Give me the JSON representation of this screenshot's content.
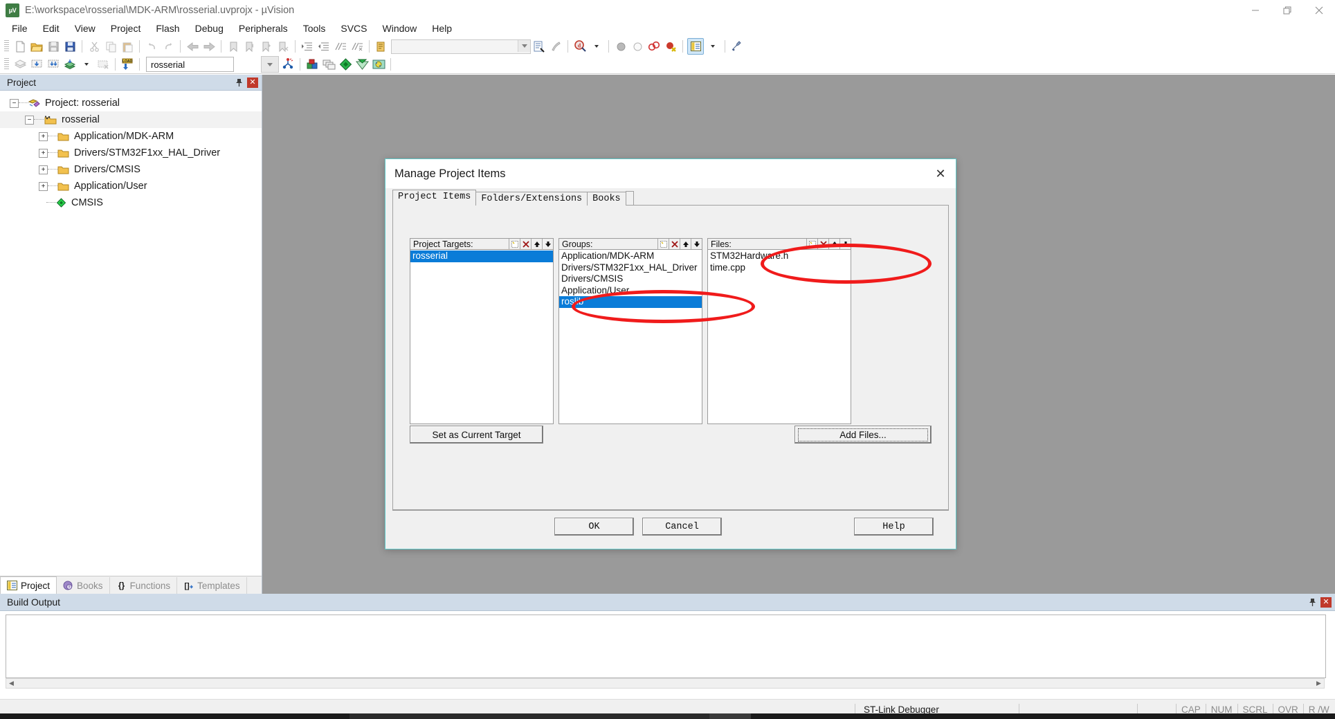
{
  "window": {
    "title": "E:\\workspace\\rosserial\\MDK-ARM\\rosserial.uvprojx - µVision",
    "app_icon": "uvision-icon",
    "minimize": "—",
    "maximize": "❐",
    "close": "✕"
  },
  "menubar": {
    "items": [
      {
        "label": "File"
      },
      {
        "label": "Edit"
      },
      {
        "label": "View"
      },
      {
        "label": "Project"
      },
      {
        "label": "Flash"
      },
      {
        "label": "Debug"
      },
      {
        "label": "Peripherals"
      },
      {
        "label": "Tools"
      },
      {
        "label": "SVCS"
      },
      {
        "label": "Window"
      },
      {
        "label": "Help"
      }
    ]
  },
  "toolbar_row1": {
    "buttons": [
      {
        "name": "new-file-icon"
      },
      {
        "name": "open-file-icon"
      },
      {
        "name": "save-icon"
      },
      {
        "name": "save-all-icon"
      },
      {
        "name": "cut-icon"
      },
      {
        "name": "copy-icon"
      },
      {
        "name": "paste-icon"
      },
      {
        "name": "undo-icon"
      },
      {
        "name": "redo-icon"
      },
      {
        "name": "navigate-back-icon"
      },
      {
        "name": "navigate-forward-icon"
      },
      {
        "name": "bookmark-toggle-icon"
      },
      {
        "name": "bookmark-prev-icon"
      },
      {
        "name": "bookmark-next-icon"
      },
      {
        "name": "bookmark-clear-icon"
      },
      {
        "name": "indent-icon"
      },
      {
        "name": "outdent-icon"
      },
      {
        "name": "comment-icon"
      },
      {
        "name": "uncomment-icon"
      },
      {
        "name": "find-in-files-icon"
      }
    ],
    "search_box_value": "",
    "search_box_placeholder": "",
    "right_buttons": [
      {
        "name": "text-search-icon"
      },
      {
        "name": "browse-symbol-icon"
      },
      {
        "name": "debug-search-icon"
      },
      {
        "name": "breakpoint-insert-icon"
      },
      {
        "name": "breakpoint-disable-icon"
      },
      {
        "name": "breakpoint-kill-all-icon"
      },
      {
        "name": "breakpoint-disable-all-icon"
      },
      {
        "name": "project-window-icon"
      },
      {
        "name": "configure-icon"
      }
    ]
  },
  "toolbar_row2": {
    "buttons": [
      {
        "name": "translate-icon"
      },
      {
        "name": "build-icon"
      },
      {
        "name": "rebuild-icon"
      },
      {
        "name": "batch-build-icon"
      },
      {
        "name": "stop-build-icon"
      },
      {
        "name": "download-icon"
      }
    ],
    "target_selector": {
      "value": "rosserial",
      "name": "target-selector"
    },
    "right_buttons": [
      {
        "name": "target-options-icon"
      },
      {
        "name": "manage-project-items-icon"
      },
      {
        "name": "multi-project-icon"
      },
      {
        "name": "pack-installer-icon"
      },
      {
        "name": "manage-run-time-env-icon"
      },
      {
        "name": "select-software-packs-icon"
      }
    ]
  },
  "project_panel": {
    "title": "Project",
    "pin_icon": "pin-icon",
    "close_icon": "close-icon",
    "tree": [
      {
        "label": "Project: rosserial",
        "icon": "project-icon",
        "expander": "−",
        "depth": 0
      },
      {
        "label": "rosserial",
        "icon": "target-icon",
        "expander": "−",
        "depth": 1
      },
      {
        "label": "Application/MDK-ARM",
        "icon": "folder-icon",
        "expander": "+",
        "depth": 2
      },
      {
        "label": "Drivers/STM32F1xx_HAL_Driver",
        "icon": "folder-icon",
        "expander": "+",
        "depth": 2
      },
      {
        "label": "Drivers/CMSIS",
        "icon": "folder-icon",
        "expander": "+",
        "depth": 2
      },
      {
        "label": "Application/User",
        "icon": "folder-icon",
        "expander": "+",
        "depth": 2
      },
      {
        "label": "CMSIS",
        "icon": "cmsis-icon",
        "expander": "",
        "depth": 2
      }
    ]
  },
  "dialog": {
    "title": "Manage Project Items",
    "close_label": "✕",
    "tabs": [
      {
        "label": "Project Items",
        "active": true
      },
      {
        "label": "Folders/Extensions",
        "active": false
      },
      {
        "label": "Books",
        "active": false
      }
    ],
    "targets_panel": {
      "header": "Project Targets:",
      "header_buttons": [
        "new-item-icon",
        "delete-item-icon",
        "move-up-icon",
        "move-down-icon"
      ],
      "items": [
        {
          "label": "rosserial",
          "selected": true
        }
      ]
    },
    "groups_panel": {
      "header": "Groups:",
      "header_buttons": [
        "new-item-icon",
        "delete-item-icon",
        "move-up-icon",
        "move-down-icon"
      ],
      "items": [
        {
          "label": "Application/MDK-ARM",
          "selected": false
        },
        {
          "label": "Drivers/STM32F1xx_HAL_Driver",
          "selected": false
        },
        {
          "label": "Drivers/CMSIS",
          "selected": false
        },
        {
          "label": "Application/User",
          "selected": false
        },
        {
          "label": "roslib",
          "selected": true
        }
      ]
    },
    "files_panel": {
      "header": "Files:",
      "header_buttons": [
        "new-item-icon",
        "delete-item-icon",
        "move-up-icon",
        "move-down-icon"
      ],
      "items": [
        {
          "label": "STM32Hardware.h",
          "selected": false
        },
        {
          "label": "time.cpp",
          "selected": false
        }
      ]
    },
    "buttons": {
      "set_as_current_target": "Set as Current Target",
      "set_as_current_target_accel": "S",
      "add_files": "Add Files...",
      "add_files_accel": "A",
      "ok": "OK",
      "cancel": "Cancel",
      "help": "Help"
    }
  },
  "annotations": {
    "accent_color": "#f01b1b",
    "highlights": [
      "files-list-oval",
      "roslib-group-oval"
    ]
  },
  "bottom_tabs": [
    {
      "label": "Project",
      "icon": "project-window-icon",
      "active": true
    },
    {
      "label": "Books",
      "icon": "books-icon",
      "active": false
    },
    {
      "label": "Functions",
      "icon": "functions-icon",
      "active": false
    },
    {
      "label": "Templates",
      "icon": "templates-icon",
      "active": false
    }
  ],
  "build_output": {
    "title": "Build Output",
    "pin_icon": "pin-icon",
    "close_icon": "close-icon",
    "text": ""
  },
  "statusbar": {
    "left": "",
    "debugger": "ST-Link Debugger",
    "indicators": [
      "CAP",
      "NUM",
      "SCRL",
      "OVR",
      "R /W"
    ]
  },
  "colors": {
    "panel_header": "#cfdbe8",
    "selection_blue": "#0a7cd8",
    "dialog_border": "#5ec8c8",
    "annotation_red": "#f01b1b",
    "editor_gray": "#9a9a9a"
  }
}
